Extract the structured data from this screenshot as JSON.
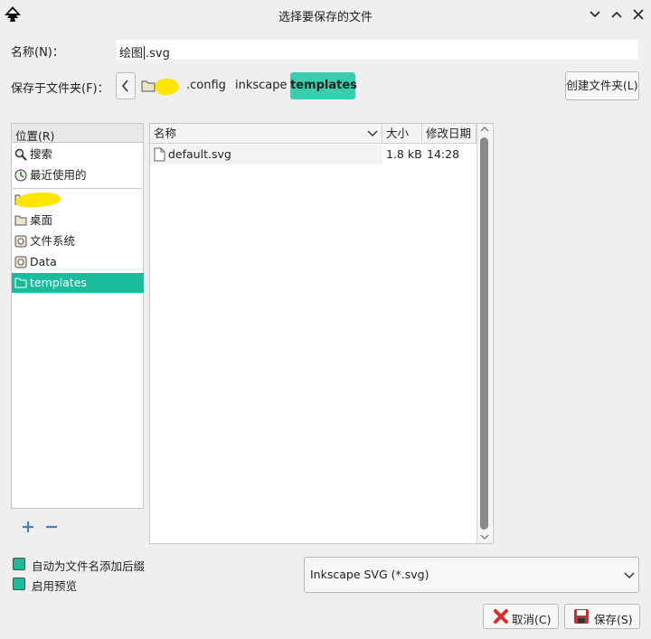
{
  "window": {
    "title": "选择要保存的文件"
  },
  "name_label": "名称(N)：",
  "filename": {
    "before_cursor": "绘图",
    "after_cursor": ".svg"
  },
  "save_in_label": "保存于文件夹(F)：",
  "breadcrumbs": [
    {
      "label": ".config"
    },
    {
      "label": "inkscape"
    },
    {
      "label": "templates"
    }
  ],
  "create_folder_label": "创建文件夹(L)",
  "places": {
    "header": "位置(R)",
    "items": [
      {
        "label": "搜索",
        "icon": "search-icon"
      },
      {
        "label": "最近使用的",
        "icon": "recent-icon"
      },
      {
        "label": "",
        "icon": "folder-icon"
      },
      {
        "label": "桌面",
        "icon": "folder-icon"
      },
      {
        "label": "文件系统",
        "icon": "drive-icon"
      },
      {
        "label": "Data",
        "icon": "drive-icon"
      },
      {
        "label": "templates",
        "icon": "folder-icon"
      }
    ]
  },
  "files": {
    "columns": [
      "名称",
      "大小",
      "修改日期"
    ],
    "rows": [
      {
        "name": "default.svg",
        "size": "1.8 kB",
        "modified": "14:28"
      }
    ]
  },
  "options": {
    "auto_extension": "自动为文件名添加后缀",
    "enable_preview": "启用预览"
  },
  "file_type": "Inkscape SVG (*.svg)",
  "buttons": {
    "cancel": "取消(C)",
    "save": "保存(S)"
  },
  "colors": {
    "accent": "#1abc9c",
    "breadcrumb_active": "#3bcdb0"
  }
}
